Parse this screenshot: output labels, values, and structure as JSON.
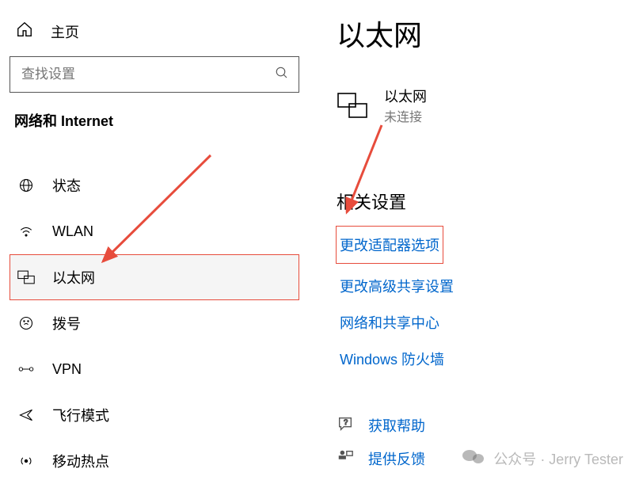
{
  "home_label": "主页",
  "search": {
    "placeholder": "查找设置"
  },
  "section_header": "网络和 Internet",
  "nav": {
    "status": "状态",
    "wlan": "WLAN",
    "ethernet": "以太网",
    "dialup": "拨号",
    "vpn": "VPN",
    "airplane": "飞行模式",
    "hotspot": "移动热点"
  },
  "page_title": "以太网",
  "ethernet_status": {
    "name": "以太网",
    "state": "未连接"
  },
  "related_header": "相关设置",
  "links": {
    "adapter_options": "更改适配器选项",
    "advanced_sharing": "更改高级共享设置",
    "network_center": "网络和共享中心",
    "firewall": "Windows 防火墙"
  },
  "support": {
    "get_help": "获取帮助",
    "feedback": "提供反馈"
  },
  "watermark": "公众号 · Jerry Tester"
}
